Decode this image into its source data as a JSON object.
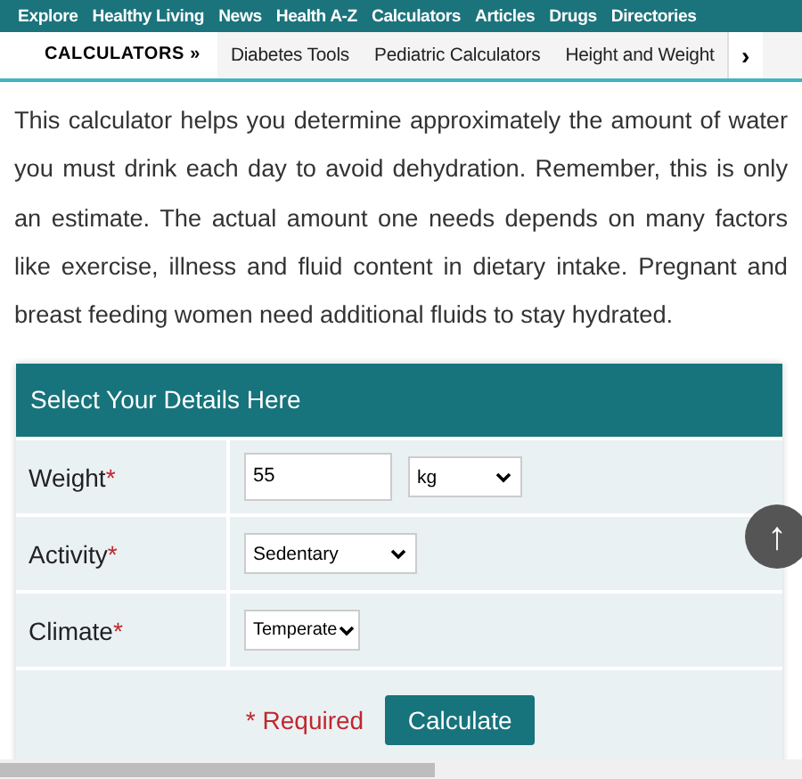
{
  "top_nav": [
    "Explore",
    "Healthy Living",
    "News",
    "Health A-Z",
    "Calculators",
    "Articles",
    "Drugs",
    "Directories"
  ],
  "sub_nav": {
    "title": "CALCULATORS",
    "title_arrow": "»",
    "items": [
      "Diabetes Tools",
      "Pediatric Calculators",
      "Height and Weight"
    ],
    "next": "›"
  },
  "intro": "This calculator helps you determine approximately the amount of water you must drink each day to avoid dehydration. Remember, this is only an estimate. The actual amount one needs depends on many factors like exercise, illness and fluid content in dietary intake. Pregnant and breast feeding women need additional fluids to stay hydrated.",
  "form": {
    "title": "Select Your Details Here",
    "rows": [
      {
        "label": "Weight",
        "mark": "*",
        "fields": [
          {
            "kind": "input",
            "value": "55"
          },
          {
            "kind": "select",
            "value": "kg"
          }
        ]
      },
      {
        "label": "Activity",
        "mark": "*",
        "fields": [
          {
            "kind": "select",
            "value": "Sedentary"
          }
        ]
      },
      {
        "label": "Climate",
        "mark": "*",
        "fields": [
          {
            "kind": "select",
            "value": "Temperate"
          }
        ]
      }
    ],
    "required_note": "* Required",
    "submit": "Calculate"
  },
  "scroll_top": "↑"
}
